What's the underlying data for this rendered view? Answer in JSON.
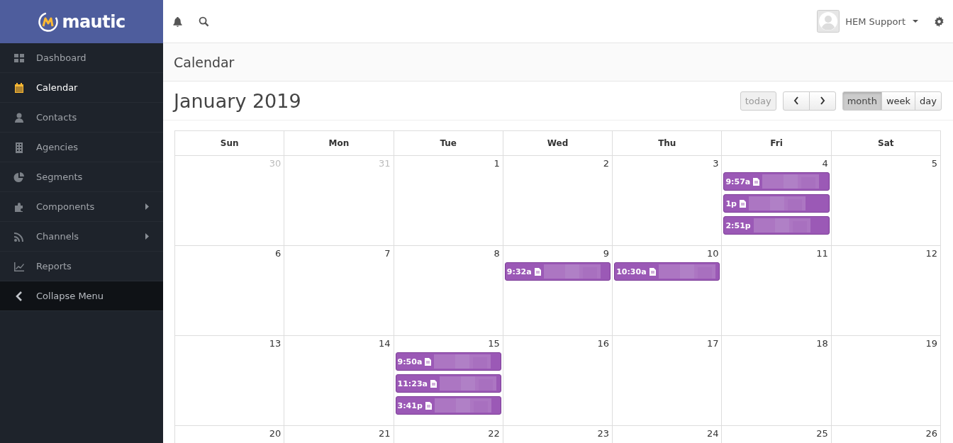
{
  "brand": {
    "name": "mautic"
  },
  "sidebar": {
    "items": [
      {
        "label": "Dashboard",
        "selected": false,
        "has_submenu": false
      },
      {
        "label": "Calendar",
        "selected": true,
        "has_submenu": false
      },
      {
        "label": "Contacts",
        "selected": false,
        "has_submenu": false
      },
      {
        "label": "Agencies",
        "selected": false,
        "has_submenu": false
      },
      {
        "label": "Segments",
        "selected": false,
        "has_submenu": false
      },
      {
        "label": "Components",
        "selected": false,
        "has_submenu": true
      },
      {
        "label": "Channels",
        "selected": false,
        "has_submenu": true
      },
      {
        "label": "Reports",
        "selected": false,
        "has_submenu": false
      }
    ],
    "collapse": {
      "label": "Collapse Menu"
    }
  },
  "topbar": {
    "user": "HEM Support"
  },
  "page": {
    "title": "Calendar"
  },
  "calendar": {
    "title": "January 2019",
    "today": {
      "label": "today",
      "disabled": true
    },
    "views": [
      {
        "label": "month",
        "selected": true
      },
      {
        "label": "week",
        "selected": false
      },
      {
        "label": "day",
        "selected": false
      }
    ],
    "weekdays": [
      "Sun",
      "Mon",
      "Tue",
      "Wed",
      "Thu",
      "Fri",
      "Sat"
    ],
    "weeks": [
      [
        {
          "day": "30",
          "other_month": true
        },
        {
          "day": "31",
          "other_month": true
        },
        {
          "day": "1",
          "other_month": false
        },
        {
          "day": "2",
          "other_month": false
        },
        {
          "day": "3",
          "other_month": false
        },
        {
          "day": "4",
          "other_month": false,
          "events": [
            {
              "time": "9:57a",
              "has_icon": true
            },
            {
              "time": "1p",
              "has_icon": true
            },
            {
              "time": "2:51p",
              "has_icon": false
            }
          ]
        },
        {
          "day": "5",
          "other_month": false
        }
      ],
      [
        {
          "day": "6",
          "other_month": false
        },
        {
          "day": "7",
          "other_month": false
        },
        {
          "day": "8",
          "other_month": false
        },
        {
          "day": "9",
          "other_month": false,
          "events": [
            {
              "time": "9:32a",
              "has_icon": true
            }
          ]
        },
        {
          "day": "10",
          "other_month": false,
          "events": [
            {
              "time": "10:30a",
              "has_icon": true
            }
          ]
        },
        {
          "day": "11",
          "other_month": false
        },
        {
          "day": "12",
          "other_month": false
        }
      ],
      [
        {
          "day": "13",
          "other_month": false
        },
        {
          "day": "14",
          "other_month": false
        },
        {
          "day": "15",
          "other_month": false,
          "events": [
            {
              "time": "9:50a",
              "has_icon": true
            },
            {
              "time": "11:23a",
              "has_icon": true
            },
            {
              "time": "3:41p",
              "has_icon": true
            }
          ]
        },
        {
          "day": "16",
          "other_month": false
        },
        {
          "day": "17",
          "other_month": false
        },
        {
          "day": "18",
          "other_month": false
        },
        {
          "day": "19",
          "other_month": false
        }
      ],
      [
        {
          "day": "20",
          "other_month": false
        },
        {
          "day": "21",
          "other_month": false
        },
        {
          "day": "22",
          "other_month": false
        },
        {
          "day": "23",
          "other_month": false
        },
        {
          "day": "24",
          "other_month": false
        },
        {
          "day": "25",
          "other_month": false
        },
        {
          "day": "26",
          "other_month": false
        }
      ]
    ]
  }
}
